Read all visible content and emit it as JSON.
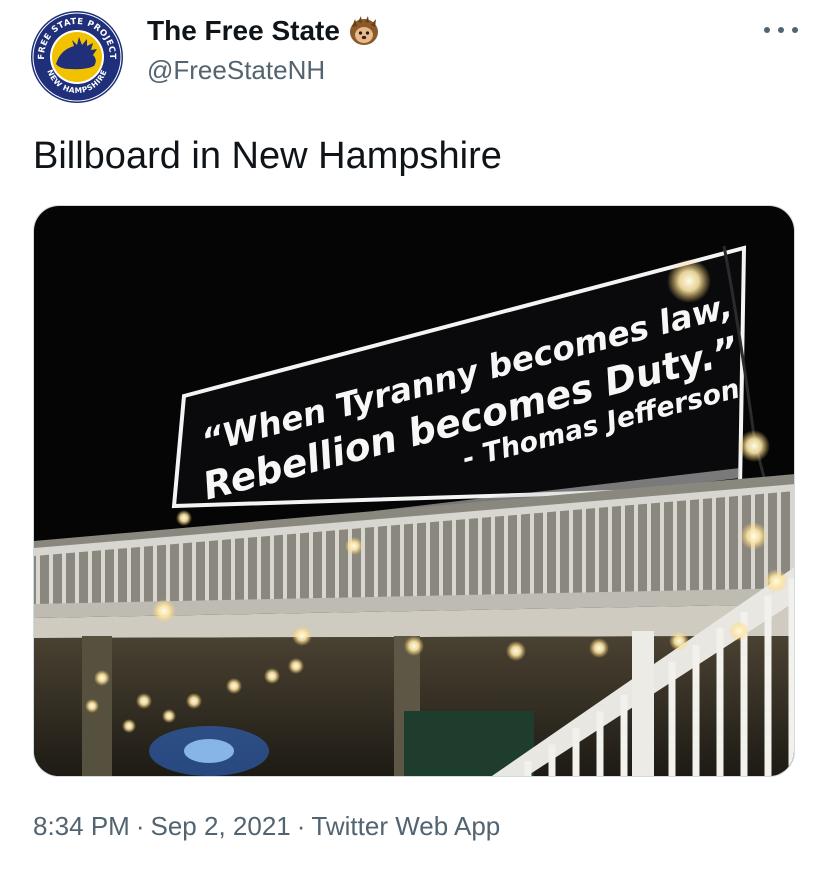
{
  "author": {
    "display_name": "The Free State",
    "handle": "@FreeStateNH",
    "badge_icon": "hedgehog-emoji",
    "avatar_logo": {
      "top_text": "FREE STATE PROJECT",
      "bottom_text": "NEW HAMPSHIRE",
      "colors": {
        "ring": "#1f2f7a",
        "fill": "#f2c200"
      }
    }
  },
  "more_icon": "ellipsis-icon",
  "tweet": {
    "text": "Billboard in New Hampshire"
  },
  "media": {
    "billboard": {
      "line1": "“When Tyranny becomes law,",
      "line2": "Rebellion becomes Duty.”",
      "attribution": "- Thomas Jefferson"
    }
  },
  "meta": {
    "time": "8:34 PM",
    "date": "Sep 2, 2021",
    "source": "Twitter Web App",
    "separator": "·"
  }
}
